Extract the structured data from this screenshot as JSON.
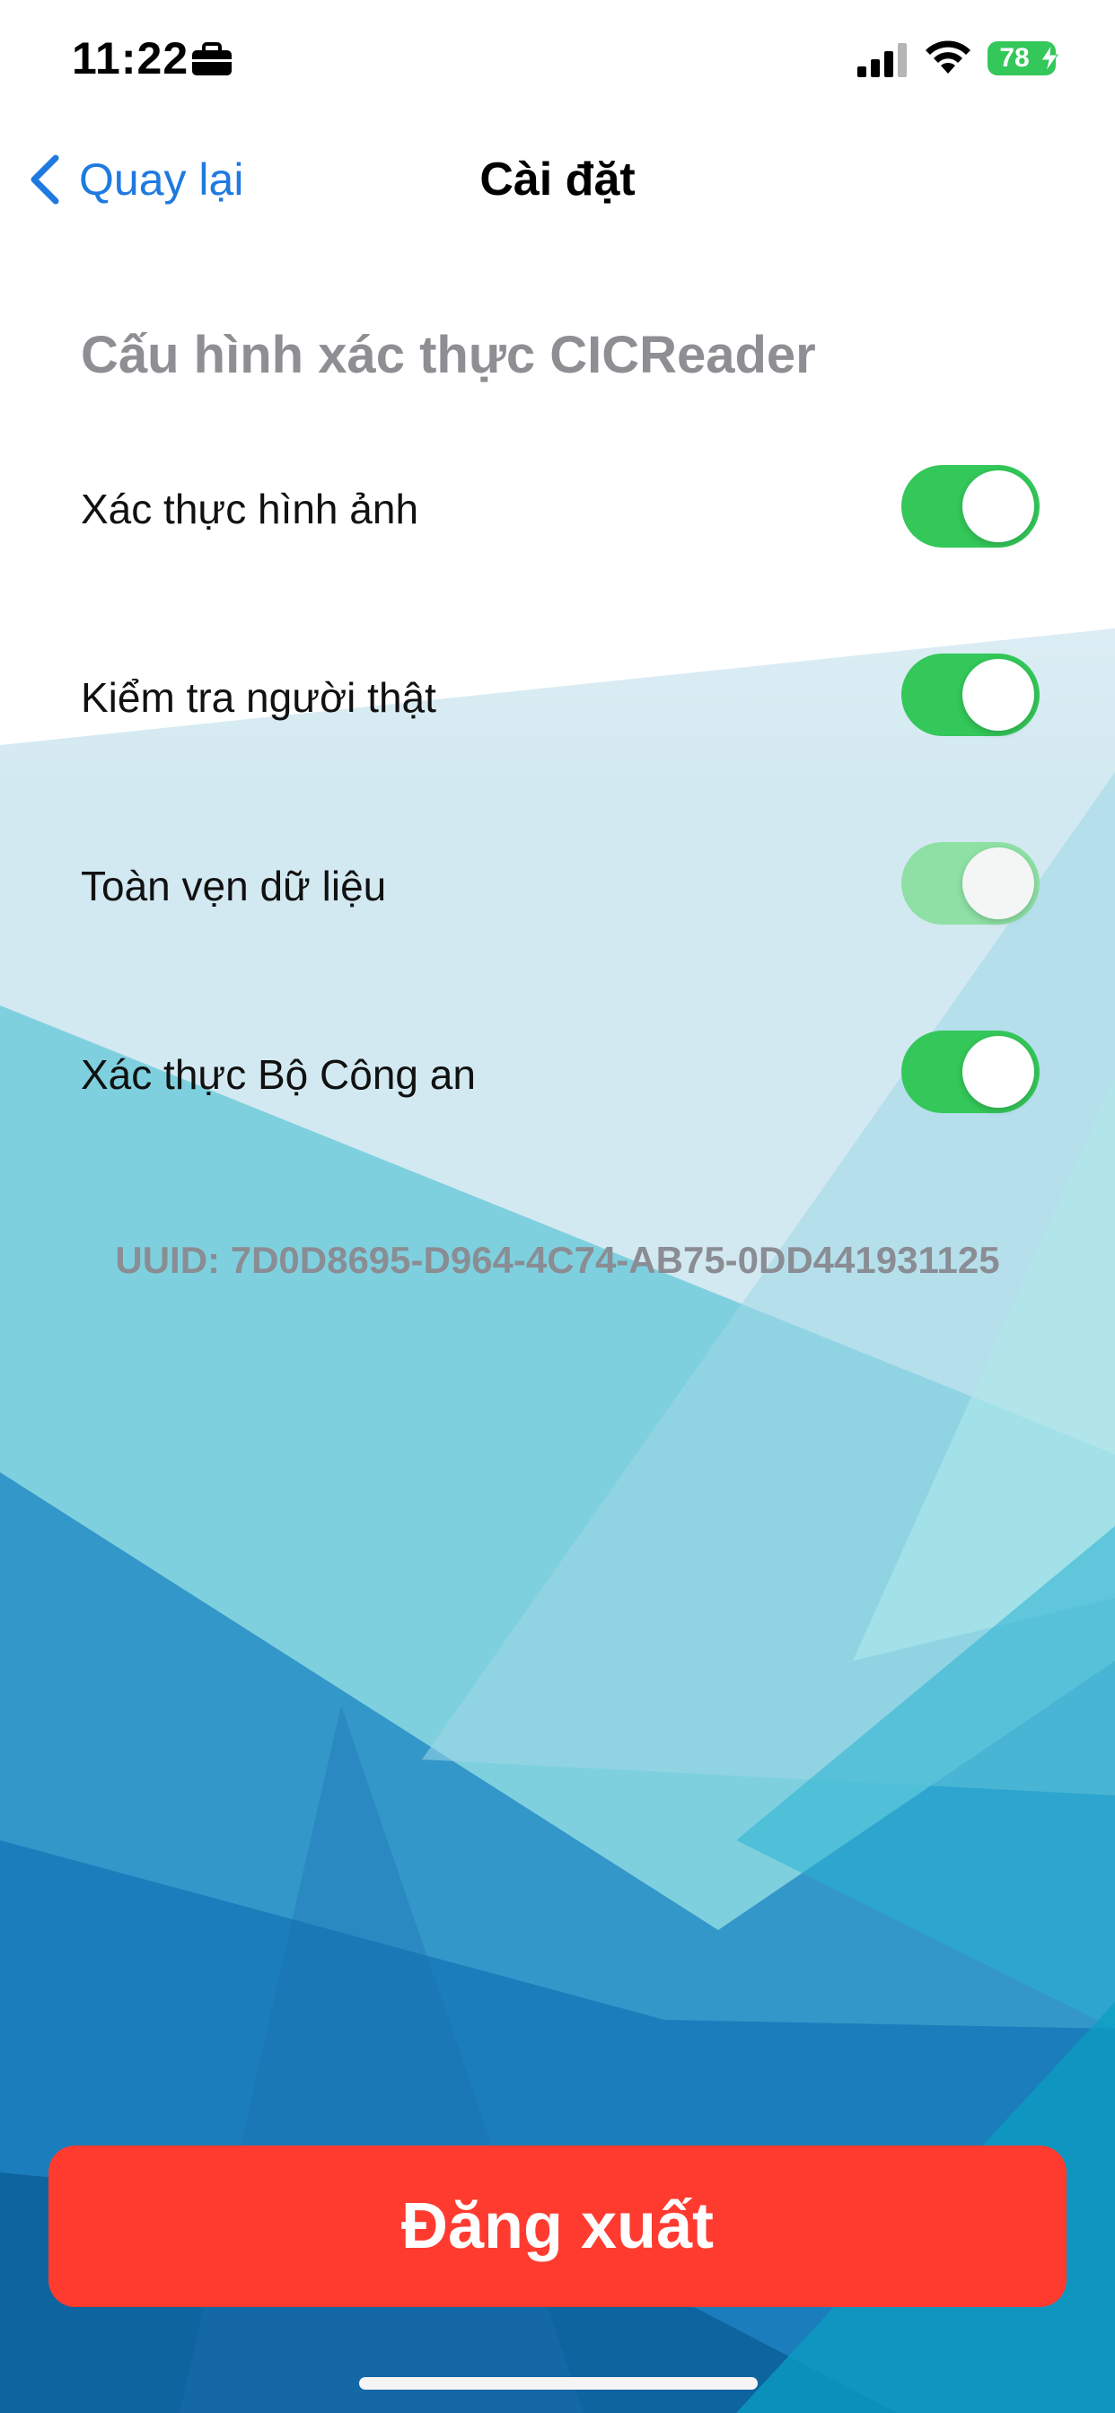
{
  "status_bar": {
    "time": "11:22",
    "battery": "78",
    "icons": [
      "briefcase-icon",
      "signal-icon",
      "wifi-icon",
      "battery-icon",
      "charging-bolt-icon"
    ]
  },
  "nav": {
    "back_label": "Quay lại",
    "back_icon": "chevron-left-icon",
    "title": "Cài đặt"
  },
  "section": {
    "title": "Cấu hình xác thực CICReader"
  },
  "settings": [
    {
      "label": "Xác thực hình ảnh",
      "on": true,
      "enabled": true
    },
    {
      "label": "Kiểm tra người thật",
      "on": true,
      "enabled": true
    },
    {
      "label": "Toàn vẹn dữ liệu",
      "on": true,
      "enabled": false
    },
    {
      "label": "Xác thực Bộ Công an",
      "on": true,
      "enabled": true
    }
  ],
  "uuid_text": "UUID: 7D0D8695-D964-4C74-AB75-0DD441931125",
  "logout_label": "Đăng xuất",
  "colors": {
    "accent": "#1f7ae0",
    "toggle_on": "#34c759",
    "toggle_disabled": "#8ee0a5",
    "logout": "#ff3b30",
    "section_title": "#8e8e93"
  }
}
